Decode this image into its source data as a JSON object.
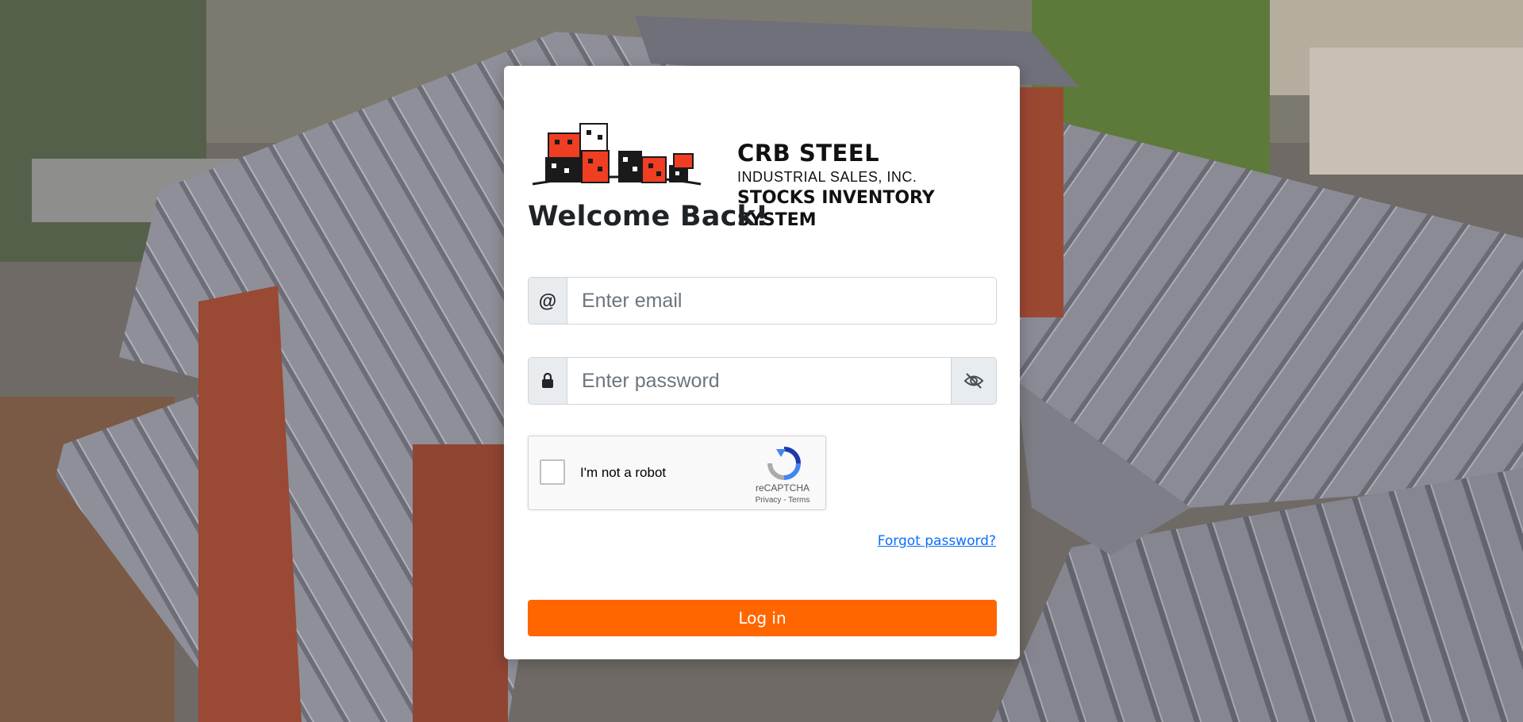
{
  "brand": {
    "name": "CRB STEEL",
    "subtitle": "INDUSTRIAL SALES, INC.",
    "system": "STOCKS INVENTORY SYSTEM",
    "logo_icon": "buildings-logo",
    "colors": {
      "red": "#f03e22",
      "dark": "#1a1a1a"
    }
  },
  "form": {
    "title": "Welcome Back!",
    "email": {
      "addon_icon": "at-icon",
      "addon_text": "@",
      "placeholder": "Enter email",
      "value": ""
    },
    "password": {
      "addon_icon": "lock-icon",
      "placeholder": "Enter password",
      "value": "",
      "toggle_icon": "eye-slash-icon"
    },
    "captcha": {
      "label": "I'm not a robot",
      "brand": "reCAPTCHA",
      "privacy": "Privacy",
      "separator": " - ",
      "terms": "Terms"
    },
    "forgot_link": "Forgot password?",
    "submit_label": "Log in"
  },
  "theme": {
    "accent": "#ff6600",
    "link": "#0d6efd",
    "card_bg": "#ffffff"
  }
}
